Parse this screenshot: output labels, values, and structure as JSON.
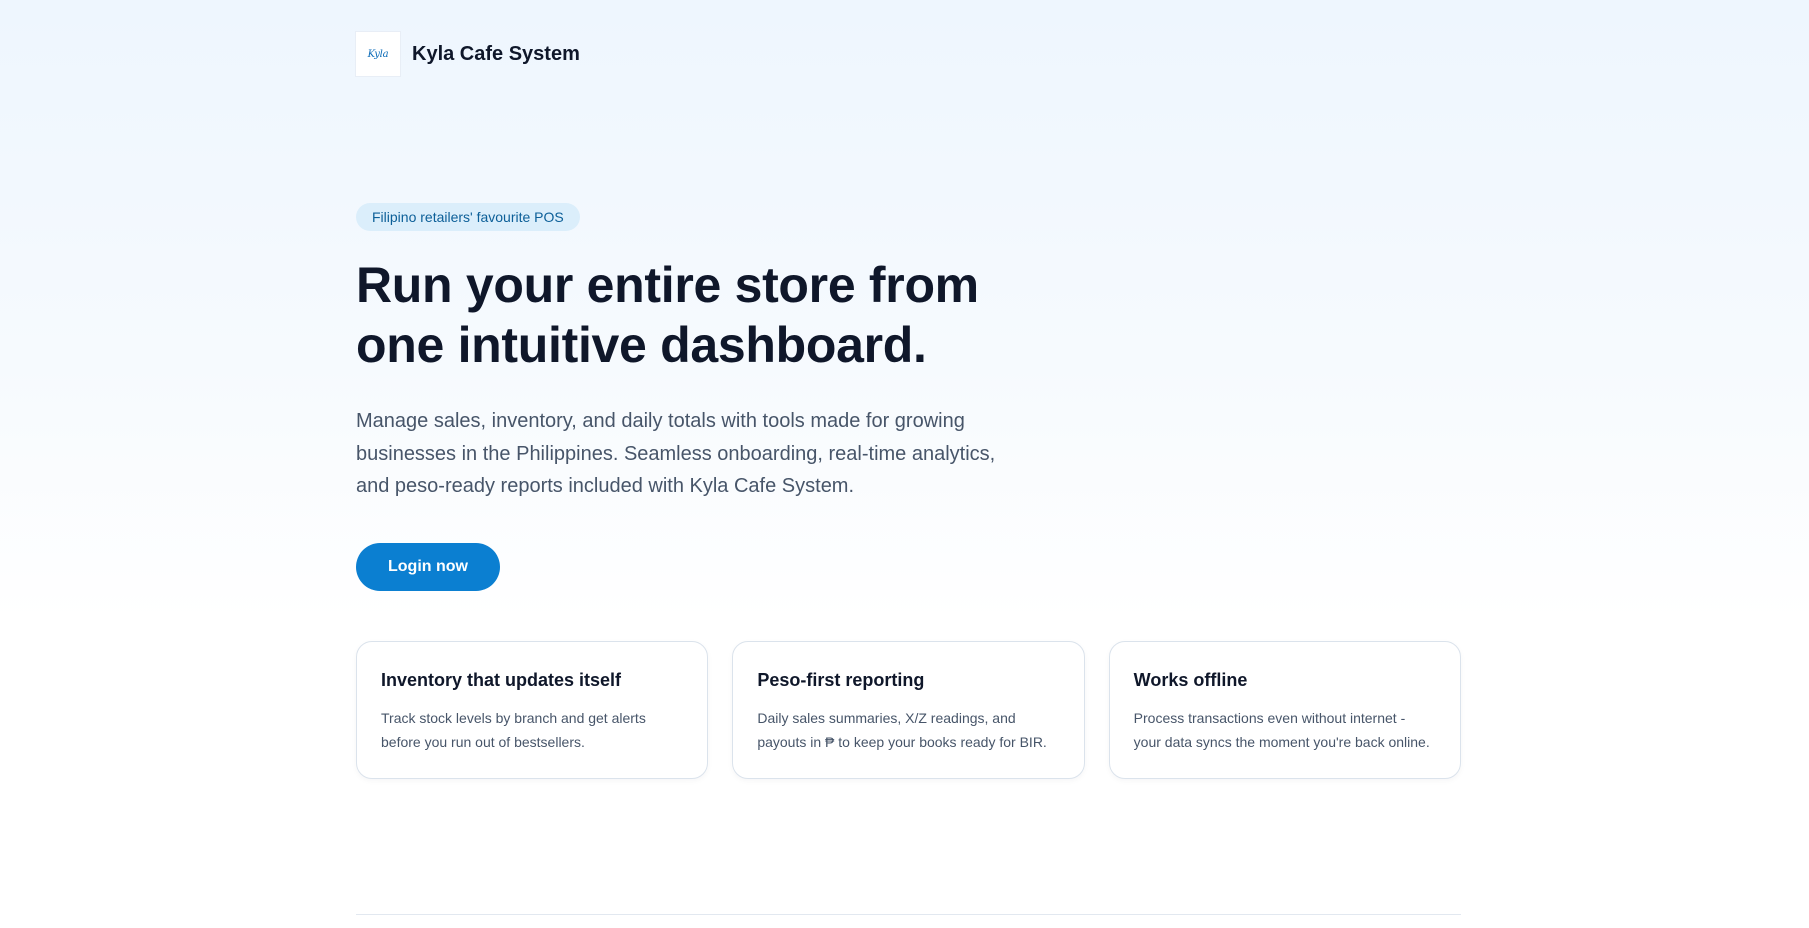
{
  "header": {
    "logo_text": "Kyla",
    "app_title": "Kyla Cafe System"
  },
  "hero": {
    "badge": "Filipino retailers' favourite POS",
    "headline": "Run your entire store from one intuitive dashboard.",
    "subtitle": "Manage sales, inventory, and daily totals with tools made for growing businesses in the Philippines. Seamless onboarding, real-time analytics, and peso-ready reports included with Kyla Cafe System.",
    "cta_label": "Login now"
  },
  "features": [
    {
      "title": "Inventory that updates itself",
      "body": "Track stock levels by branch and get alerts before you run out of bestsellers."
    },
    {
      "title": "Peso-first reporting",
      "body": "Daily sales summaries, X/Z readings, and payouts in ₱ to keep your books ready for BIR."
    },
    {
      "title": "Works offline",
      "body": "Process transactions even without internet - your data syncs the moment you're back online."
    }
  ],
  "colors": {
    "primary": "#0b7fd1",
    "badge_bg": "#dbeefb",
    "badge_text": "#0c5f98",
    "heading": "#0f172a",
    "body_text": "#475569"
  }
}
